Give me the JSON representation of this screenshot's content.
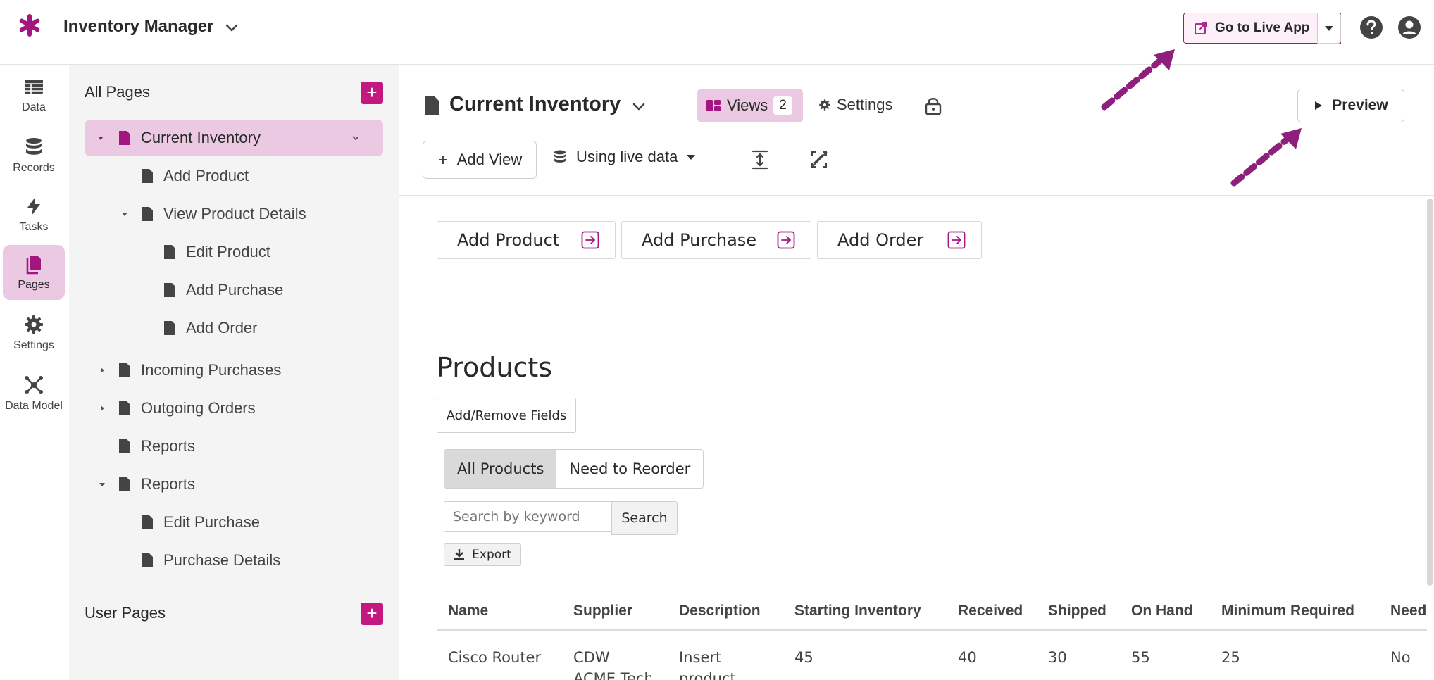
{
  "topbar": {
    "app_title": "Inventory Manager",
    "go_live_label": "Go to Live App"
  },
  "rail": {
    "items": [
      {
        "label": "Data",
        "icon": "table-icon"
      },
      {
        "label": "Records",
        "icon": "database-icon"
      },
      {
        "label": "Tasks",
        "icon": "lightning-icon"
      },
      {
        "label": "Pages",
        "icon": "pages-icon"
      },
      {
        "label": "Settings",
        "icon": "gear-icon"
      },
      {
        "label": "Data Model",
        "icon": "graph-icon"
      }
    ]
  },
  "sidebar": {
    "all_pages_title": "All Pages",
    "user_pages_title": "User Pages",
    "tree": [
      {
        "label": "Current Inventory"
      },
      {
        "label": "Add Product"
      },
      {
        "label": "View Product Details"
      },
      {
        "label": "Edit Product"
      },
      {
        "label": "Add Purchase"
      },
      {
        "label": "Add Order"
      },
      {
        "label": "Incoming Purchases"
      },
      {
        "label": "Outgoing Orders"
      },
      {
        "label": "Reports"
      },
      {
        "label": "Reports"
      },
      {
        "label": "Edit Purchase"
      },
      {
        "label": "Purchase Details"
      }
    ]
  },
  "page": {
    "title": "Current Inventory",
    "views_label": "Views",
    "views_count": "2",
    "settings_label": "Settings",
    "preview_label": "Preview",
    "add_view_label": "Add View",
    "data_source_label": "Using live data"
  },
  "canvas": {
    "nav_buttons": [
      {
        "label": "Add Product"
      },
      {
        "label": "Add Purchase"
      },
      {
        "label": "Add Order"
      }
    ],
    "section_title": "Products",
    "fields_button": "Add/Remove Fields",
    "tabs": [
      {
        "label": "All Products",
        "active": true
      },
      {
        "label": "Need to Reorder",
        "active": false
      }
    ],
    "search_placeholder": "Search by keyword",
    "search_button": "Search",
    "export_button": "Export",
    "columns": [
      "Name",
      "Supplier",
      "Description",
      "Starting Inventory",
      "Received",
      "Shipped",
      "On Hand",
      "Minimum Required",
      "Need"
    ],
    "row": [
      "Cisco Router",
      "CDW",
      "Insert",
      "45",
      "40",
      "30",
      "55",
      "25",
      "No"
    ],
    "row_overflow": [
      "ACME Tech",
      "product"
    ]
  },
  "colors": {
    "accent": "#a3167f",
    "accent_light": "#ebc9e3",
    "add_button": "#c2187f",
    "annotation_arrow": "#8e1f7d"
  }
}
